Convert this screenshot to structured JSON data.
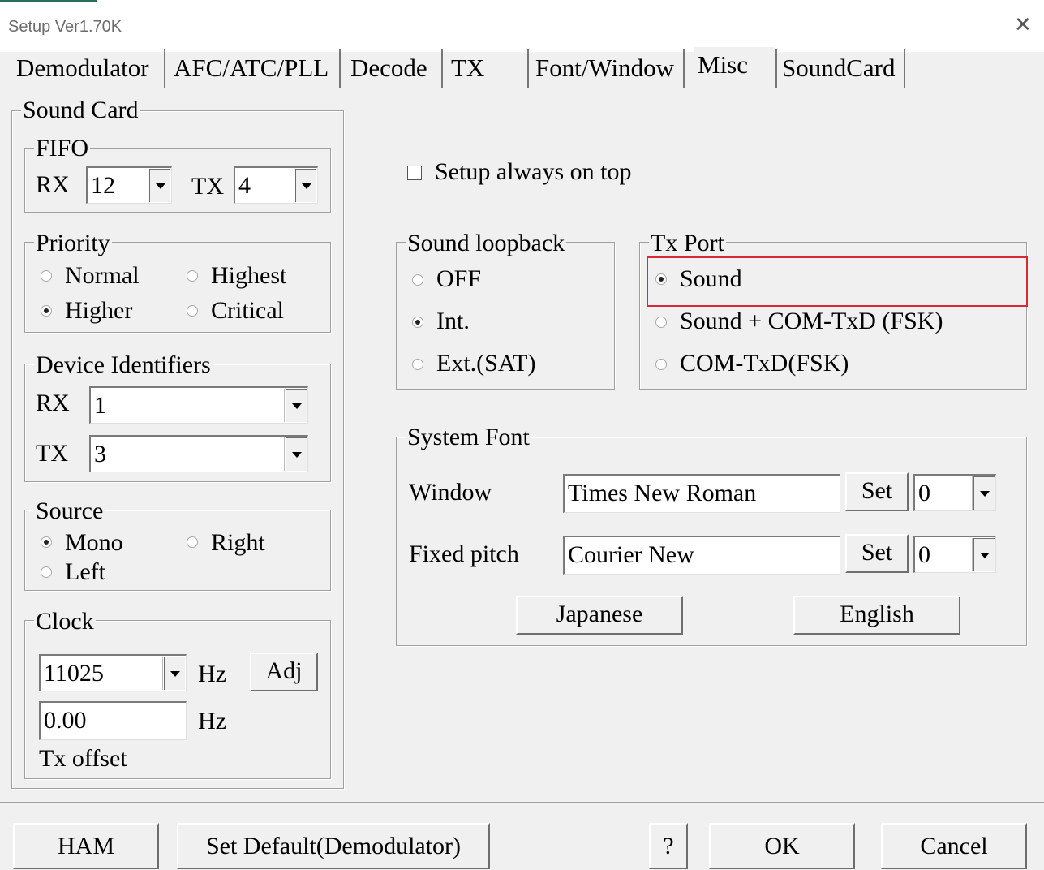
{
  "window": {
    "title": "Setup Ver1.70K"
  },
  "tabs": [
    "Demodulator",
    "AFC/ATC/PLL",
    "Decode",
    "TX",
    "Font/Window",
    "Misc",
    "SoundCard"
  ],
  "sound_card": {
    "title": "Sound Card",
    "fifo": {
      "title": "FIFO",
      "rx_label": "RX",
      "rx_value": "12",
      "tx_label": "TX",
      "tx_value": "4"
    },
    "priority": {
      "title": "Priority",
      "normal": "Normal",
      "highest": "Highest",
      "higher": "Higher",
      "critical": "Critical",
      "selected": "Higher"
    },
    "device_identifiers": {
      "title": "Device Identifiers",
      "rx_label": "RX",
      "rx_value": "1",
      "tx_label": "TX",
      "tx_value": "3"
    },
    "source": {
      "title": "Source",
      "mono": "Mono",
      "right": "Right",
      "left": "Left",
      "selected": "Mono"
    },
    "clock": {
      "title": "Clock",
      "value": "11025",
      "hz1": "Hz",
      "adj": "Adj",
      "offset_value": "0.00",
      "hz2": "Hz",
      "tx_offset_label": "Tx offset"
    }
  },
  "misc": {
    "always_on_top": "Setup always on top",
    "loopback": {
      "title": "Sound loopback",
      "off": "OFF",
      "int": "Int.",
      "ext": "Ext.(SAT)",
      "selected": "Int."
    },
    "tx_port": {
      "title": "Tx Port",
      "sound": "Sound",
      "sound_com": "Sound + COM-TxD (FSK)",
      "com": "COM-TxD(FSK)",
      "selected": "Sound"
    },
    "system_font": {
      "title": "System Font",
      "window_label": "Window",
      "window_font": "Times New Roman",
      "window_set": "Set",
      "window_size": "0",
      "fixed_label": "Fixed pitch",
      "fixed_font": "Courier New",
      "fixed_set": "Set",
      "fixed_size": "0",
      "japanese": "Japanese",
      "english": "English"
    }
  },
  "buttons": {
    "ham": "HAM",
    "set_default": "Set Default(Demodulator)",
    "help": "?",
    "ok": "OK",
    "cancel": "Cancel"
  },
  "colors": {
    "highlight": "#d9283a",
    "background": "#f0f0f0"
  }
}
